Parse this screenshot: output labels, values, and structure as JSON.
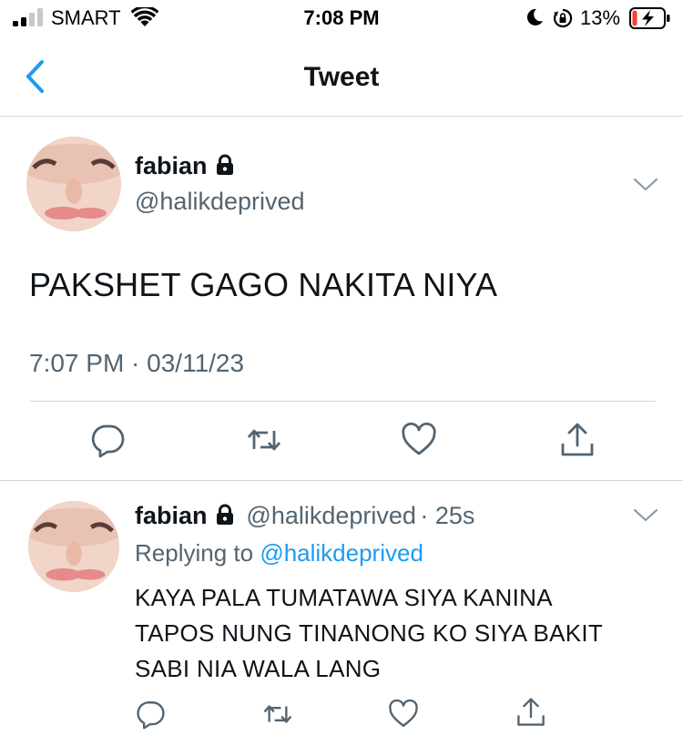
{
  "status_bar": {
    "carrier": "SMART",
    "time": "7:08 PM",
    "battery_percent": "13%",
    "battery_level": 0.13,
    "icons": [
      "signal-icon",
      "wifi-icon",
      "moon-icon",
      "rotation-lock-icon",
      "battery-charging-icon"
    ]
  },
  "nav": {
    "title": "Tweet",
    "back_icon": "chevron-left-icon"
  },
  "tweet": {
    "name": "fabian",
    "handle": "@halikdeprived",
    "text": "PAKSHET GAGO NAKITA NIYA",
    "timestamp": "7:07 PM · 03/11/23",
    "actions": [
      "reply-icon",
      "retweet-icon",
      "like-icon",
      "share-icon"
    ]
  },
  "reply": {
    "name": "fabian",
    "handle": "@halikdeprived",
    "age": "· 25s",
    "replying_prefix": "Replying to",
    "replying_handle": "@halikdeprived",
    "lines": [
      "KAYA PALA TUMATAWA SIYA KANINA",
      "TAPOS NUNG TINANONG KO SIYA BAKIT",
      "SABI NIA WALA LANG"
    ],
    "actions": [
      "reply-icon",
      "retweet-icon",
      "like-icon",
      "share-icon"
    ]
  },
  "colors": {
    "accent": "#1d9bf0",
    "text": "#0f1419",
    "secondary": "#536471",
    "divider": "#cfd9de"
  }
}
